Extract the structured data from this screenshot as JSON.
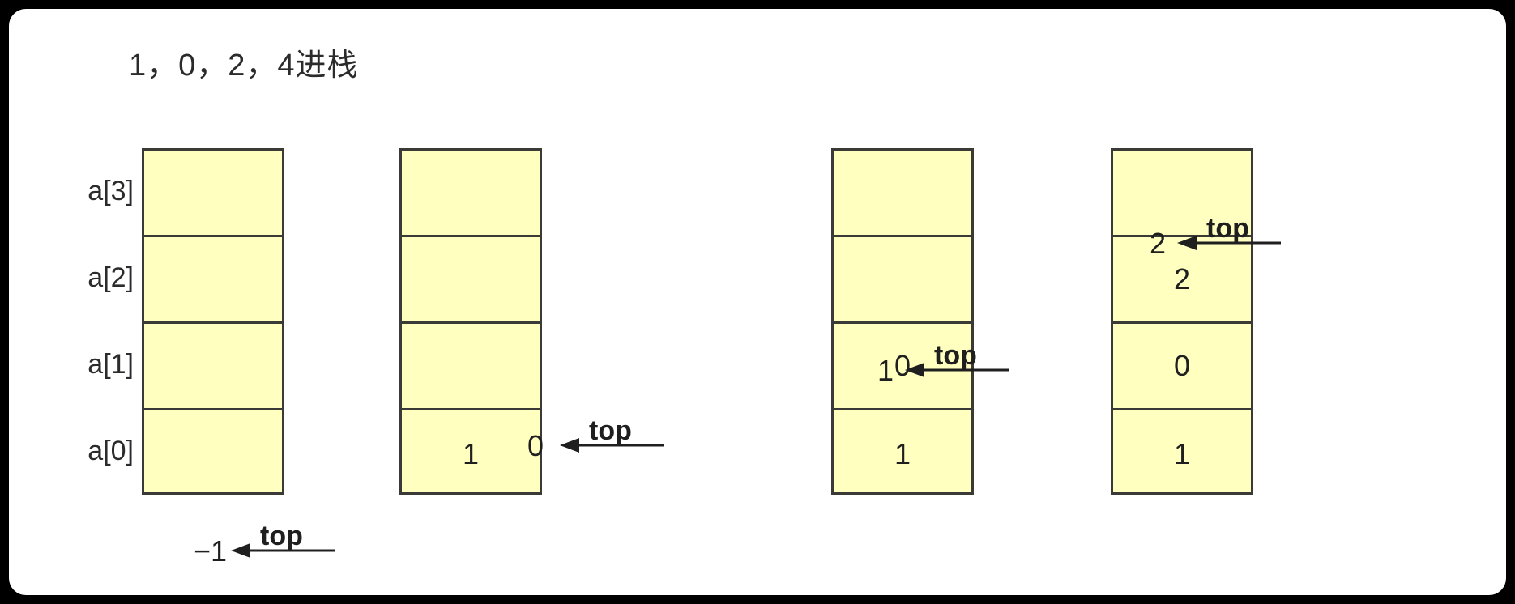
{
  "diagram": {
    "title": "1，0，2，4进栈",
    "row_labels": [
      "a[3]",
      "a[2]",
      "a[1]",
      "a[0]"
    ],
    "colors": {
      "cell_fill": "#ffffc0",
      "cell_border": "#3a3a36",
      "frame_border": "#000000",
      "background": "#ffffff",
      "text": "#1f1f1f"
    },
    "pointer_label": "top",
    "stacks": [
      {
        "name": "stack-empty",
        "cells": [
          "",
          "",
          "",
          ""
        ],
        "top_value": "−1"
      },
      {
        "name": "stack-after-push-1",
        "cells": [
          "",
          "",
          "",
          "1"
        ],
        "top_value": "0"
      },
      {
        "name": "stack-after-push-0",
        "cells": [
          "",
          "",
          "0",
          "1"
        ],
        "top_value": "1"
      },
      {
        "name": "stack-after-push-2",
        "cells": [
          "",
          "2",
          "0",
          "1"
        ],
        "top_value": "2"
      }
    ]
  }
}
